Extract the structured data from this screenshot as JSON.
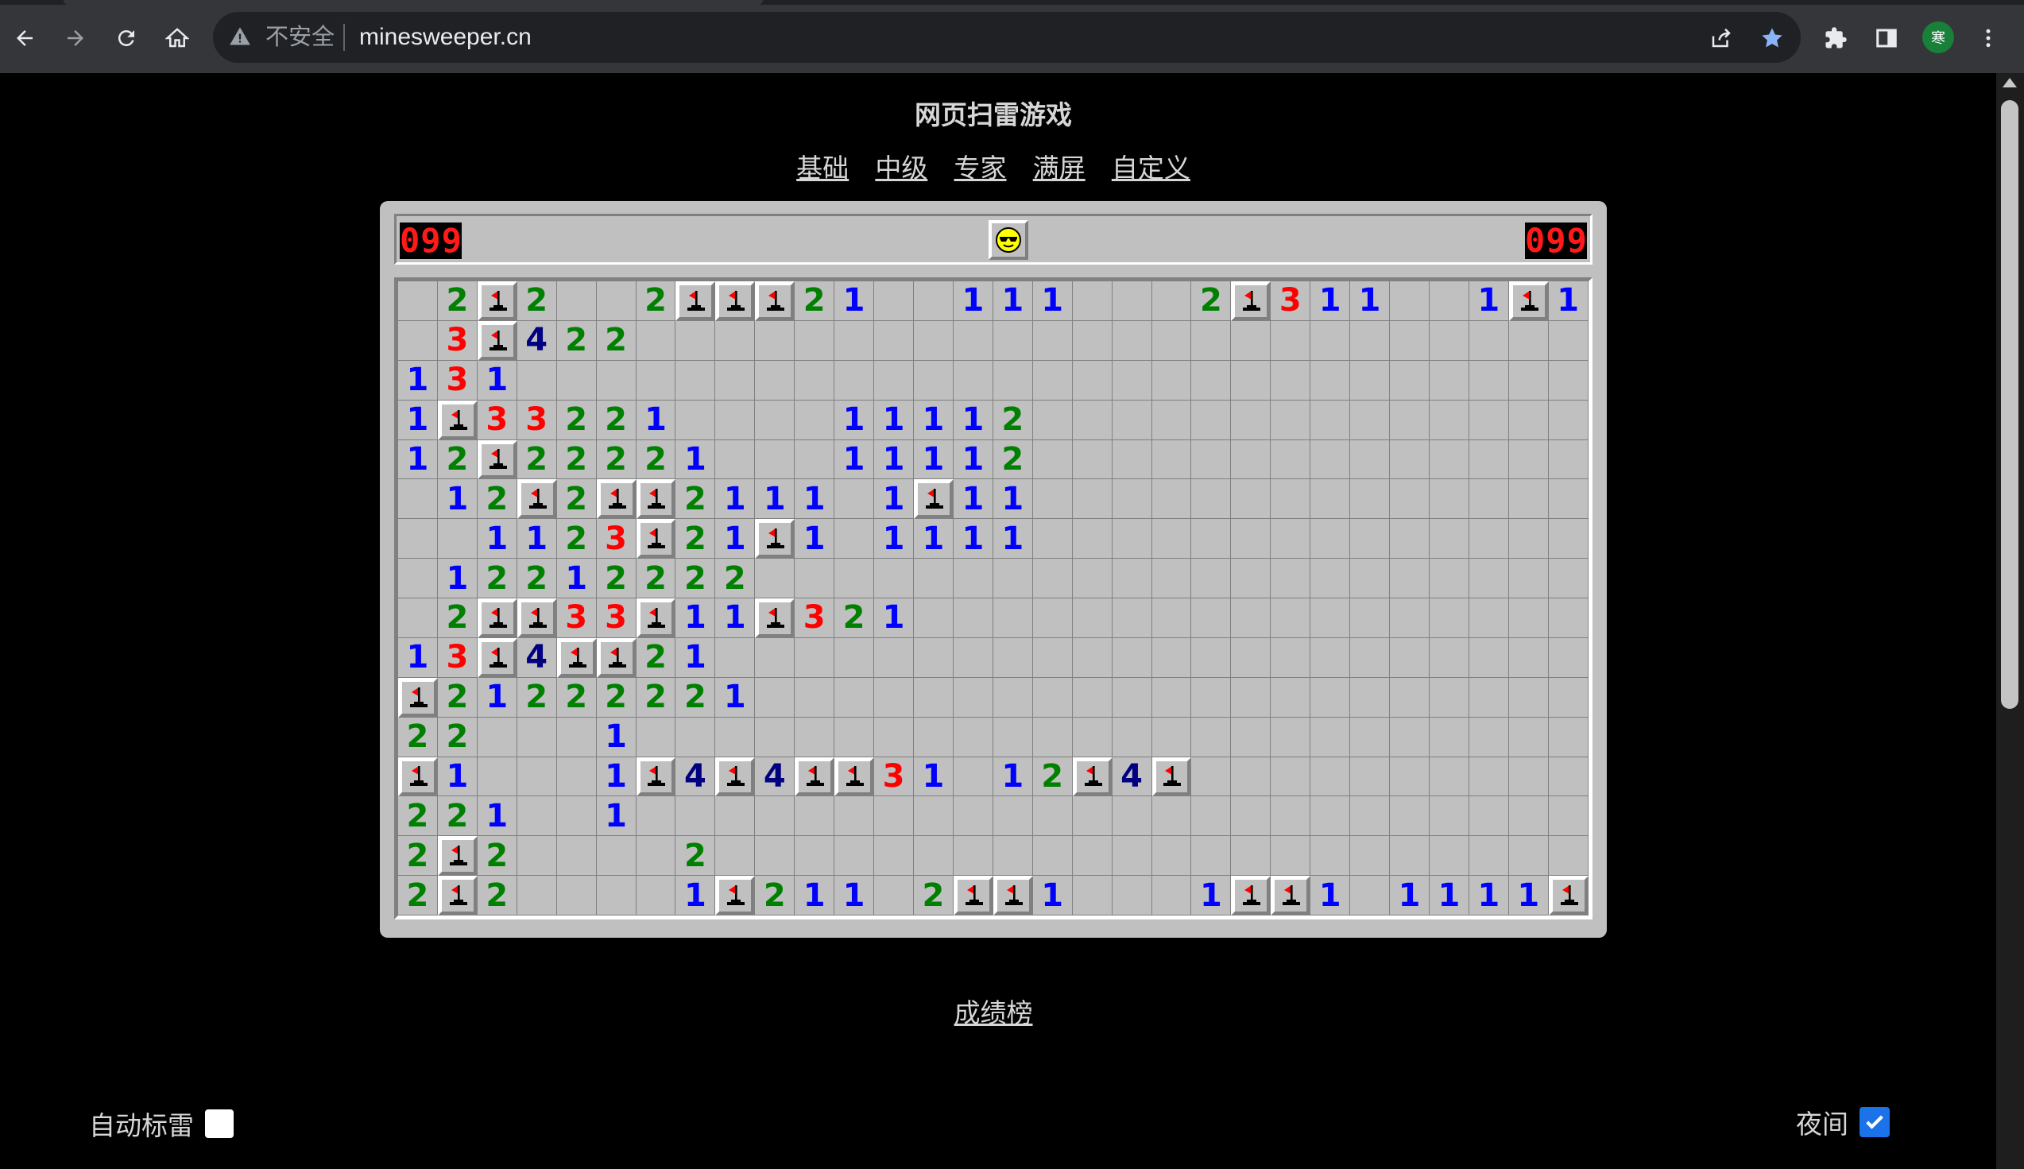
{
  "browser": {
    "security_label": "不安全",
    "url": "minesweeper.cn",
    "avatar_text": "寒"
  },
  "page": {
    "title": "网页扫雷游戏",
    "levels": [
      "基础",
      "中级",
      "专家",
      "满屏",
      "自定义"
    ],
    "leaderboard_link": "成绩榜",
    "auto_flag_label": "自动标雷",
    "auto_flag_checked": false,
    "night_label": "夜间",
    "night_checked": true
  },
  "game": {
    "mine_counter": "099",
    "time_counter": "099",
    "face": "cool",
    "cols": 30,
    "rows": 16,
    "board": [
      ".2F2..2FFF21..111...2F311..1F1",
      ".3F422",
      "131",
      "1F33221....11112",
      "12F22221...11112",
      ".12F2FF2111.1F11",
      "..1123F21F1.1111",
      ".12212222",
      ".2FF33F11F321...",
      "13F4FF21",
      "F21222221",
      "22...1",
      "F1...1F4F4FF31.12F4F",
      "221..1",
      "2F2....2",
      "2F2....1F211.2FF1...1FF1.1111F"
    ]
  }
}
